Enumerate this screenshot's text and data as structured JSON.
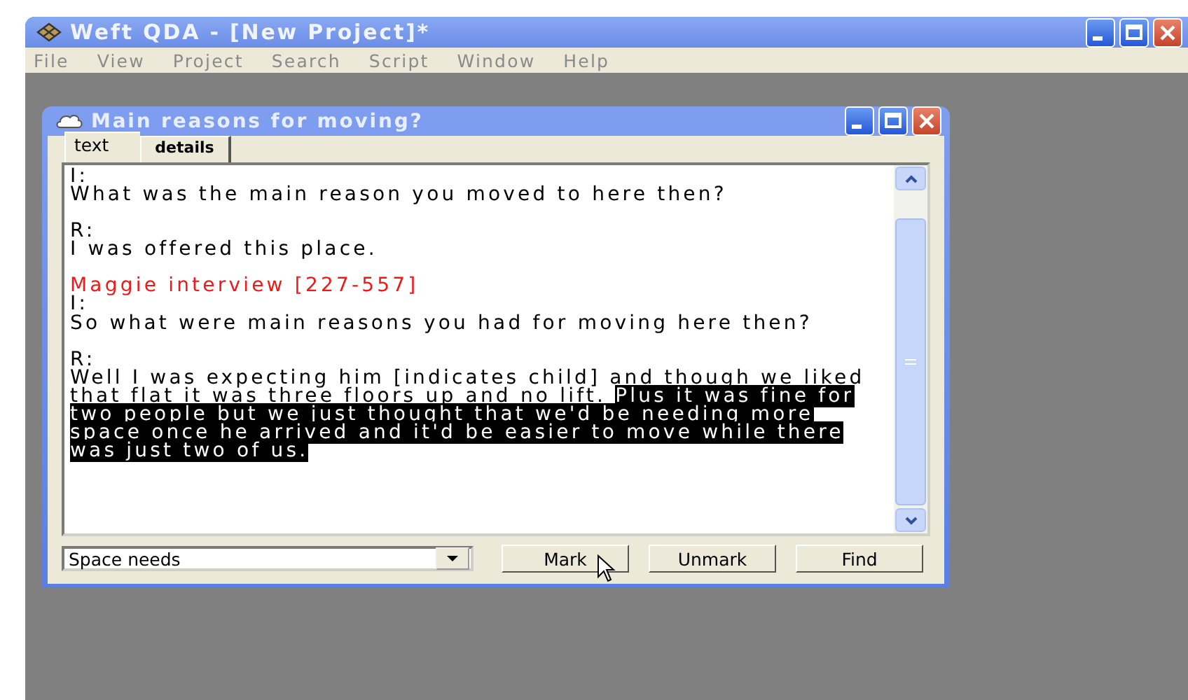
{
  "window": {
    "title": "Weft QDA - [New Project]*"
  },
  "menu": [
    "File",
    "View",
    "Project",
    "Search",
    "Script",
    "Window",
    "Help"
  ],
  "document_window": {
    "title": "Main reasons for moving?",
    "tabs": [
      {
        "label": "text",
        "selected": true
      },
      {
        "label": "details",
        "selected": false
      }
    ],
    "entries": [
      {
        "kind": "speaker",
        "text": "I:"
      },
      {
        "kind": "utterance",
        "runs": [
          {
            "text": "What was the main reason you moved to here then?",
            "selected": false
          }
        ]
      },
      {
        "kind": "speaker",
        "text": "R:"
      },
      {
        "kind": "utterance",
        "runs": [
          {
            "text": "I was offered this place.",
            "selected": false
          }
        ]
      },
      {
        "kind": "source",
        "text": "Maggie interview [227-557]"
      },
      {
        "kind": "speaker",
        "text": "I:"
      },
      {
        "kind": "utterance",
        "runs": [
          {
            "text": "So what were main reasons you had for moving here then?",
            "selected": false
          }
        ]
      },
      {
        "kind": "speaker",
        "text": "R:"
      },
      {
        "kind": "utterance",
        "runs": [
          {
            "text": "Well I was expecting him [indicates child] and though we liked that flat it was three floors up and no lift. ",
            "selected": false
          },
          {
            "text": "Plus it was fine for two people but we just thought that we'd be needing more space once he arrived and it'd be easier to move while there was just two of us.",
            "selected": true
          }
        ]
      }
    ],
    "code_dropdown": {
      "value": "Space needs"
    },
    "buttons": [
      "Mark",
      "Unmark",
      "Find"
    ]
  }
}
